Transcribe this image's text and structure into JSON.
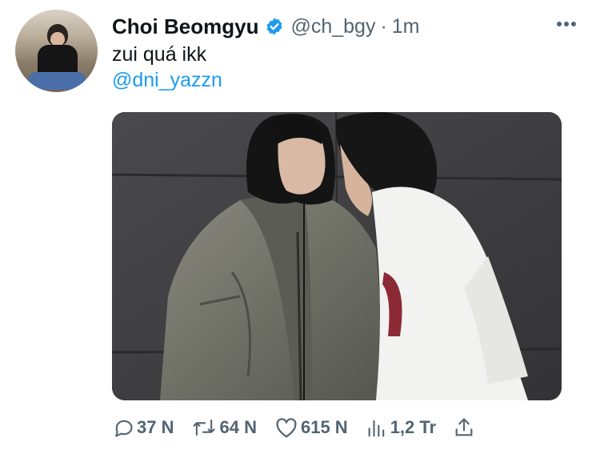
{
  "tweet": {
    "author_name": "Choi Beomgyu",
    "handle": "@ch_bgy",
    "separator": "·",
    "time": "1m",
    "text": "zui quá ikk",
    "mention": "@dni_yazzn"
  },
  "icons": {
    "verified": "verified-badge-icon",
    "more": "more-options-icon",
    "reply": "reply-icon",
    "retweet": "retweet-icon",
    "like": "like-icon",
    "views": "views-icon",
    "share": "share-icon"
  },
  "actions": {
    "reply_count": "37 N",
    "retweet_count": "64 N",
    "like_count": "615 N",
    "view_count": "1,2 Tr"
  },
  "colors": {
    "link": "#1d9bf0",
    "secondary_text": "#536471",
    "verified": "#1d9bf0"
  }
}
